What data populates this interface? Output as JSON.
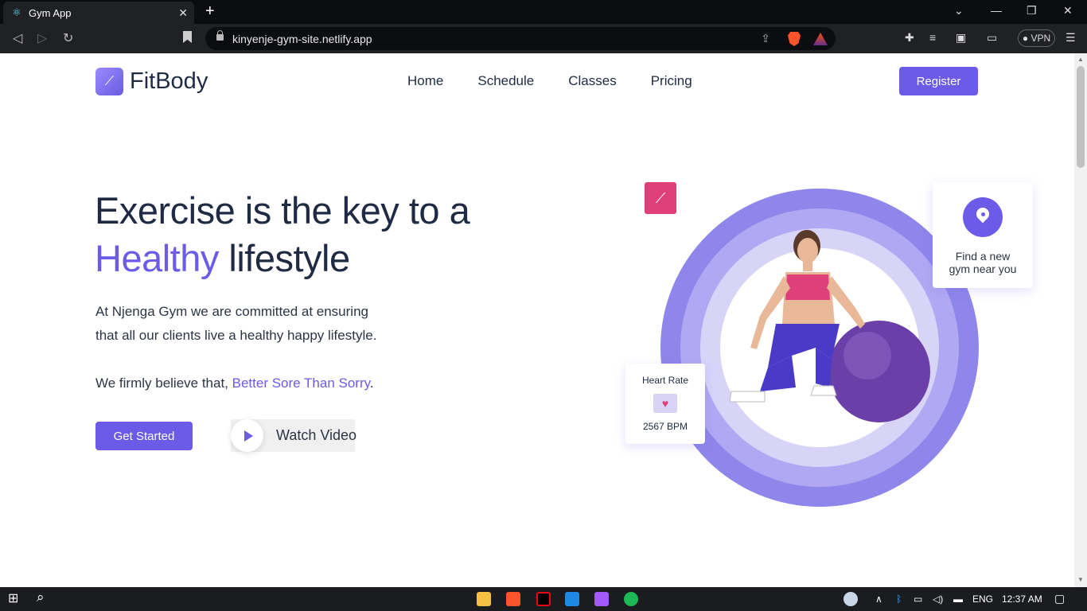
{
  "browser": {
    "tab_title": "Gym App",
    "url": "kinyenje-gym-site.netlify.app",
    "vpn_label": "VPN"
  },
  "site": {
    "brand": "FitBody",
    "nav": [
      "Home",
      "Schedule",
      "Classes",
      "Pricing"
    ],
    "register_label": "Register",
    "hero": {
      "title_line1": "Exercise is the key to a",
      "title_accent": "Healthy",
      "title_rest": " lifestyle",
      "para_line1": "At Njenga Gym we are committed at ensuring",
      "para_line2": "that all our clients live a healthy happy lifestyle.",
      "belief_prefix": "We firmly believe that, ",
      "belief_accent": "Better Sore Than Sorry",
      "belief_suffix": ".",
      "get_started_label": "Get Started",
      "watch_label": "Watch Video"
    },
    "cards": {
      "gym_line1": "Find a new",
      "gym_line2": "gym near you",
      "heart_title": "Heart Rate",
      "heart_value": "2567 BPM"
    }
  },
  "taskbar": {
    "language": "ENG",
    "time": "12:37 AM"
  },
  "colors": {
    "accent": "#6c5ae8",
    "pink": "#e0407a",
    "text": "#1f2a44"
  },
  "icons": [
    "react-icon",
    "dumbbell-icon",
    "location-pin-icon",
    "heart-pulse-icon",
    "play-icon"
  ]
}
